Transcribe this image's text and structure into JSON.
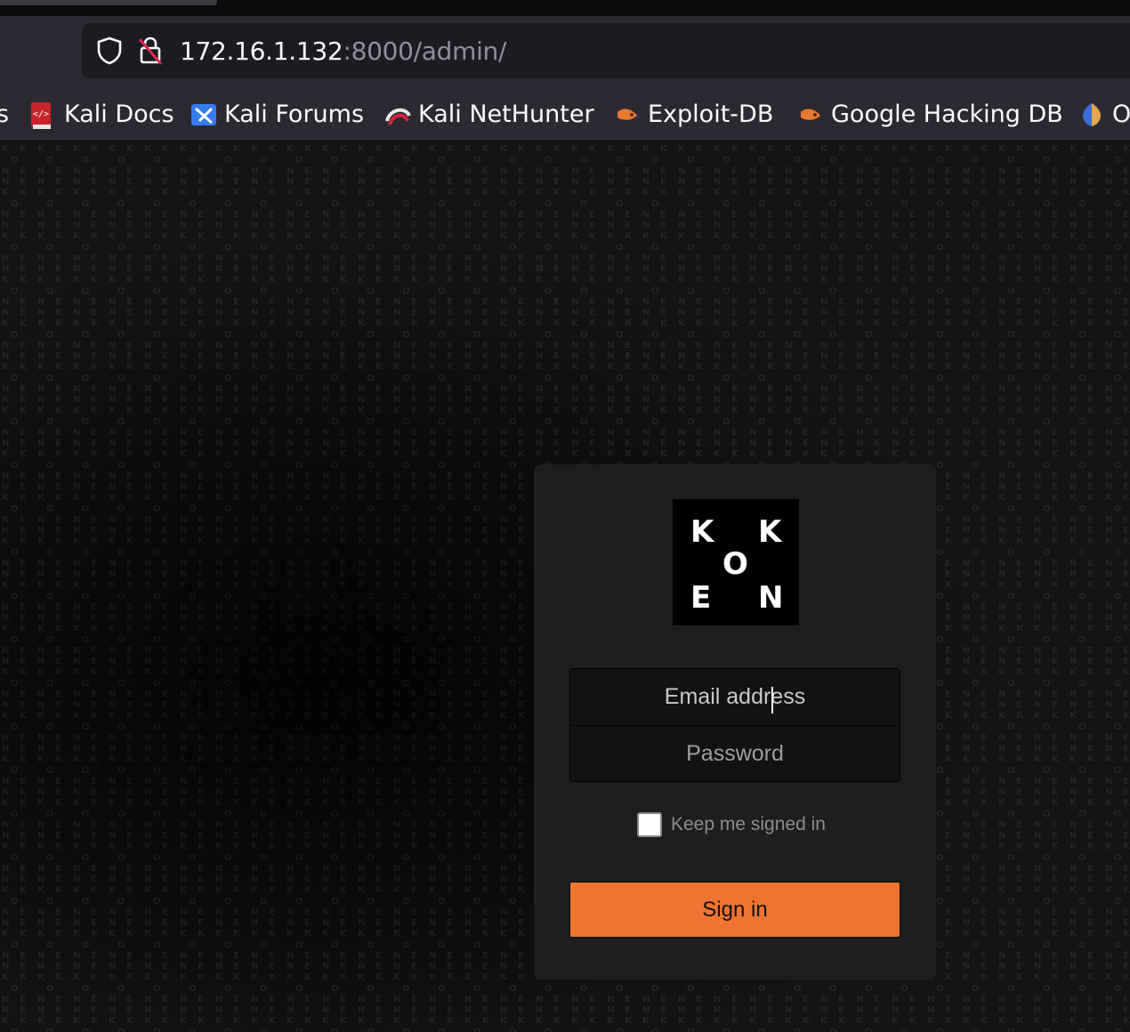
{
  "browser": {
    "url_host": "172.16.1.132",
    "url_rest": ":8000/admin/",
    "bookmarks": [
      {
        "label": "s",
        "icon": "bookmark-icon"
      },
      {
        "label": "Kali Docs",
        "icon": "kali-docs-icon"
      },
      {
        "label": "Kali Forums",
        "icon": "kali-forums-icon"
      },
      {
        "label": "Kali NetHunter",
        "icon": "kali-nethunter-icon"
      },
      {
        "label": "Exploit-DB",
        "icon": "exploit-db-icon"
      },
      {
        "label": "Google Hacking DB",
        "icon": "google-hacking-db-icon"
      },
      {
        "label": "O",
        "icon": "offsec-icon"
      }
    ]
  },
  "login": {
    "logo_letters": [
      "K",
      "K",
      "O",
      "E",
      "N"
    ],
    "email_placeholder": "Email address",
    "password_placeholder": "Password",
    "keep_signed_in_label": "Keep me signed in",
    "keep_signed_in_checked": false,
    "signin_label": "Sign in"
  },
  "colors": {
    "accent": "#ee7431",
    "card": "#1e1e1f",
    "background": "#141415"
  }
}
